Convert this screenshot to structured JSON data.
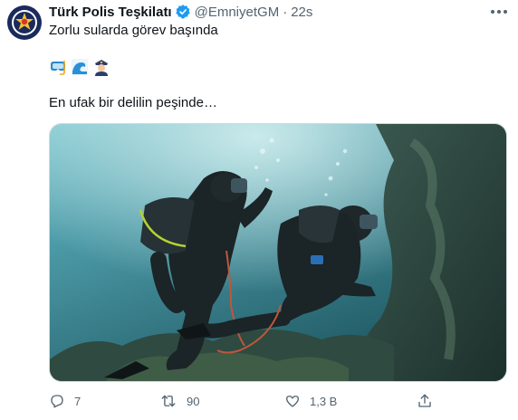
{
  "tweet": {
    "display_name": "Türk Polis Teşkilatı",
    "handle": "@EmniyetGM",
    "separator": "·",
    "time": "22s",
    "line1": "Zorlu sularda görev başında",
    "emojis": [
      "diving-mask-emoji",
      "water-wave-emoji",
      "police-officer-emoji"
    ],
    "line3": "En ufak bir delilin peşinde…"
  },
  "actions": {
    "replies": "7",
    "retweets": "90",
    "likes": "1,3 B"
  },
  "colors": {
    "verified": "#1d9bf0",
    "text": "#0f1419",
    "muted": "#536471",
    "water_dark": "#0d3b44",
    "water_light": "#5fb5c2"
  }
}
